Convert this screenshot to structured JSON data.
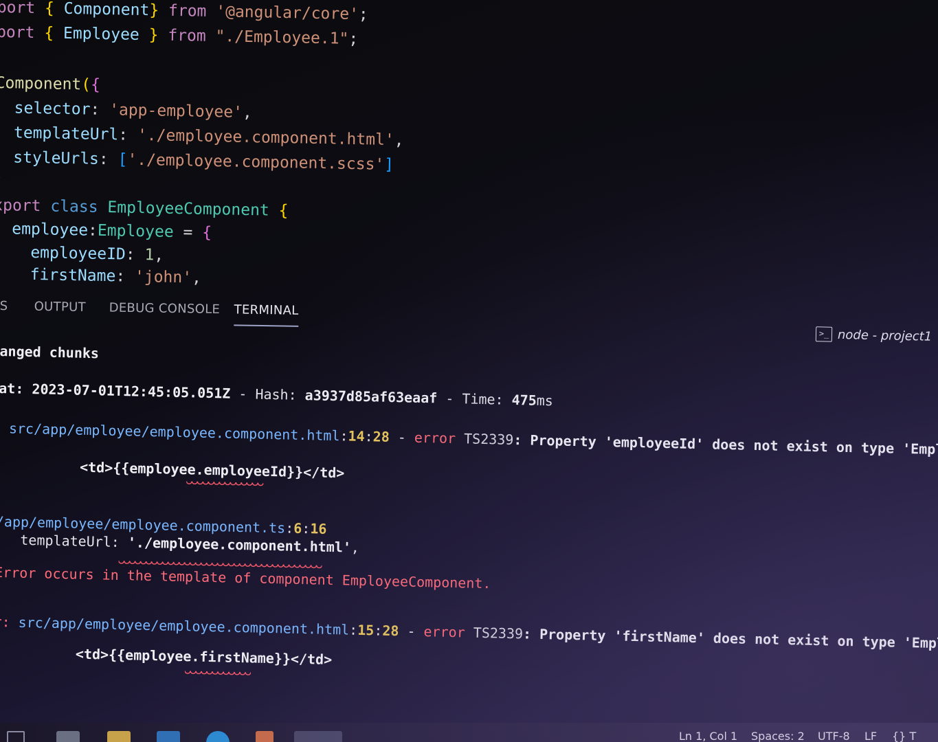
{
  "editor": {
    "lines": [
      [
        {
          "t": "port ",
          "c": "kw-pink"
        },
        {
          "t": "{ ",
          "c": "brace-y"
        },
        {
          "t": "Component",
          "c": "ident"
        },
        {
          "t": "} ",
          "c": "brace-y"
        },
        {
          "t": "from ",
          "c": "kw-pink"
        },
        {
          "t": "'@angular/core'",
          "c": "str"
        },
        {
          "t": ";",
          "c": "punc"
        }
      ],
      [
        {
          "t": "port ",
          "c": "kw-pink"
        },
        {
          "t": "{ ",
          "c": "brace-y"
        },
        {
          "t": "Employee ",
          "c": "ident"
        },
        {
          "t": "} ",
          "c": "brace-y"
        },
        {
          "t": "from ",
          "c": "kw-pink"
        },
        {
          "t": "\"./Employee.1\"",
          "c": "str"
        },
        {
          "t": ";",
          "c": "punc"
        }
      ],
      [],
      [
        {
          "t": "Component",
          "c": "dec"
        },
        {
          "t": "(",
          "c": "brace-y"
        },
        {
          "t": "{",
          "c": "brace-p"
        }
      ],
      [
        {
          "t": "  selector",
          "c": "ident"
        },
        {
          "t": ": ",
          "c": "punc"
        },
        {
          "t": "'app-employee'",
          "c": "str"
        },
        {
          "t": ",",
          "c": "punc"
        }
      ],
      [
        {
          "t": "  templateUrl",
          "c": "ident"
        },
        {
          "t": ": ",
          "c": "punc"
        },
        {
          "t": "'./employee.component.html'",
          "c": "str"
        },
        {
          "t": ",",
          "c": "punc"
        }
      ],
      [
        {
          "t": "  styleUrls",
          "c": "ident"
        },
        {
          "t": ": ",
          "c": "punc"
        },
        {
          "t": "[",
          "c": "brace-b"
        },
        {
          "t": "'./employee.component.scss'",
          "c": "str"
        },
        {
          "t": "]",
          "c": "brace-b"
        }
      ],
      [
        {
          "t": ")",
          "c": "brace-y"
        }
      ],
      [
        {
          "t": "xport ",
          "c": "kw-pink"
        },
        {
          "t": "class ",
          "c": "kw-blue"
        },
        {
          "t": "EmployeeComponent ",
          "c": "cls"
        },
        {
          "t": "{",
          "c": "brace-y"
        }
      ],
      [
        {
          "t": "  employee",
          "c": "ident"
        },
        {
          "t": ":",
          "c": "punc"
        },
        {
          "t": "Employee ",
          "c": "cls"
        },
        {
          "t": "= ",
          "c": "punc"
        },
        {
          "t": "{",
          "c": "brace-p"
        }
      ],
      [
        {
          "t": "    employeeID",
          "c": "ident"
        },
        {
          "t": ": ",
          "c": "punc"
        },
        {
          "t": "1",
          "c": "num"
        },
        {
          "t": ",",
          "c": "punc"
        }
      ],
      [
        {
          "t": "    firstName",
          "c": "ident"
        },
        {
          "t": ": ",
          "c": "punc"
        },
        {
          "t": "'john'",
          "c": "str"
        },
        {
          "t": ",",
          "c": "punc"
        }
      ]
    ]
  },
  "panel": {
    "tabs": [
      {
        "label": "S",
        "active": false
      },
      {
        "label": "OUTPUT",
        "active": false
      },
      {
        "label": "DEBUG CONSOLE",
        "active": false
      },
      {
        "label": "TERMINAL",
        "active": true
      }
    ],
    "terminal_name": "node - project1",
    "terminal_icon": "terminal-prompt-icon"
  },
  "terminal": {
    "lines": [
      [
        {
          "t": "anged chunks",
          "c": "t-white"
        }
      ],
      [],
      [
        {
          "t": "at: ",
          "c": "t-white"
        },
        {
          "t": "2023-07-01T12:45:05.051Z",
          "c": "t-white"
        },
        {
          "t": " - Hash: ",
          "c": "t-plain"
        },
        {
          "t": "a3937d85af63eaaf",
          "c": "t-white"
        },
        {
          "t": " - Time: ",
          "c": "t-plain"
        },
        {
          "t": "475",
          "c": "t-white"
        },
        {
          "t": "ms",
          "c": "t-plain"
        }
      ],
      [
        {
          "t": " src/app/employee/employee.component.html",
          "c": "t-cyan"
        },
        {
          "t": ":",
          "c": "t-plain"
        },
        {
          "t": "14",
          "c": "t-yellow"
        },
        {
          "t": ":",
          "c": "t-plain"
        },
        {
          "t": "28",
          "c": "t-yellow"
        },
        {
          "t": " - ",
          "c": "t-plain"
        },
        {
          "t": "error ",
          "c": "t-red"
        },
        {
          "t": "TS2339",
          "c": "t-errcode"
        },
        {
          "t": ": Property ",
          "c": "t-prop"
        },
        {
          "t": "'employeeId'",
          "c": "t-prop"
        },
        {
          "t": " does not exist on type ",
          "c": "t-prop"
        },
        {
          "t": "'Employee'",
          "c": "t-prop"
        },
        {
          "t": ".",
          "c": "t-prop"
        }
      ],
      [],
      [
        {
          "t": "          <td>{{employee.employeeId}}</td>",
          "c": "t-white"
        }
      ],
      [],
      [],
      [
        {
          "t": "/app/employee/employee.component.ts",
          "c": "t-cyan"
        },
        {
          "t": ":",
          "c": "t-plain"
        },
        {
          "t": "6",
          "c": "t-yellow"
        },
        {
          "t": ":",
          "c": "t-plain"
        },
        {
          "t": "16",
          "c": "t-yellow"
        }
      ],
      [
        {
          "t": "   templateUrl: ",
          "c": "t-plain"
        },
        {
          "t": "'./employee.component.html'",
          "c": "t-white"
        },
        {
          "t": ",",
          "c": "t-plain"
        }
      ],
      [],
      [
        {
          "t": "Error occurs in the template of component EmployeeComponent.",
          "c": "t-red"
        }
      ],
      [],
      [],
      [
        {
          "t": "r: ",
          "c": "t-red"
        },
        {
          "t": "src/app/employee/employee.component.html",
          "c": "t-cyan"
        },
        {
          "t": ":",
          "c": "t-plain"
        },
        {
          "t": "15",
          "c": "t-yellow"
        },
        {
          "t": ":",
          "c": "t-plain"
        },
        {
          "t": "28",
          "c": "t-yellow"
        },
        {
          "t": " - ",
          "c": "t-plain"
        },
        {
          "t": "error ",
          "c": "t-red"
        },
        {
          "t": "TS2339",
          "c": "t-errcode"
        },
        {
          "t": ": Property ",
          "c": "t-prop"
        },
        {
          "t": "'firstName'",
          "c": "t-prop"
        },
        {
          "t": " does not exist on type ",
          "c": "t-prop"
        },
        {
          "t": "'Employee'",
          "c": "t-prop"
        },
        {
          "t": ".",
          "c": "t-prop"
        }
      ],
      [],
      [
        {
          "t": "          <td>{{employee.firstName}}</td>",
          "c": "t-white"
        }
      ]
    ]
  },
  "statusbar": {
    "position": "Ln 1, Col 1",
    "spaces": "Spaces: 2",
    "encoding": "UTF-8",
    "eol": "LF",
    "language_braces": "{} T"
  },
  "taskbar": {
    "icons": [
      "task-view-icon",
      "briefcase-icon",
      "folder-icon",
      "mail-icon",
      "browser-icon",
      "app-icon",
      "vscode-icon"
    ]
  },
  "colors": {
    "error": "#ff6b78",
    "path": "#79b8ff",
    "linecol": "#e8c65a",
    "string": "#ce9178",
    "identifier": "#9cdcfe"
  }
}
